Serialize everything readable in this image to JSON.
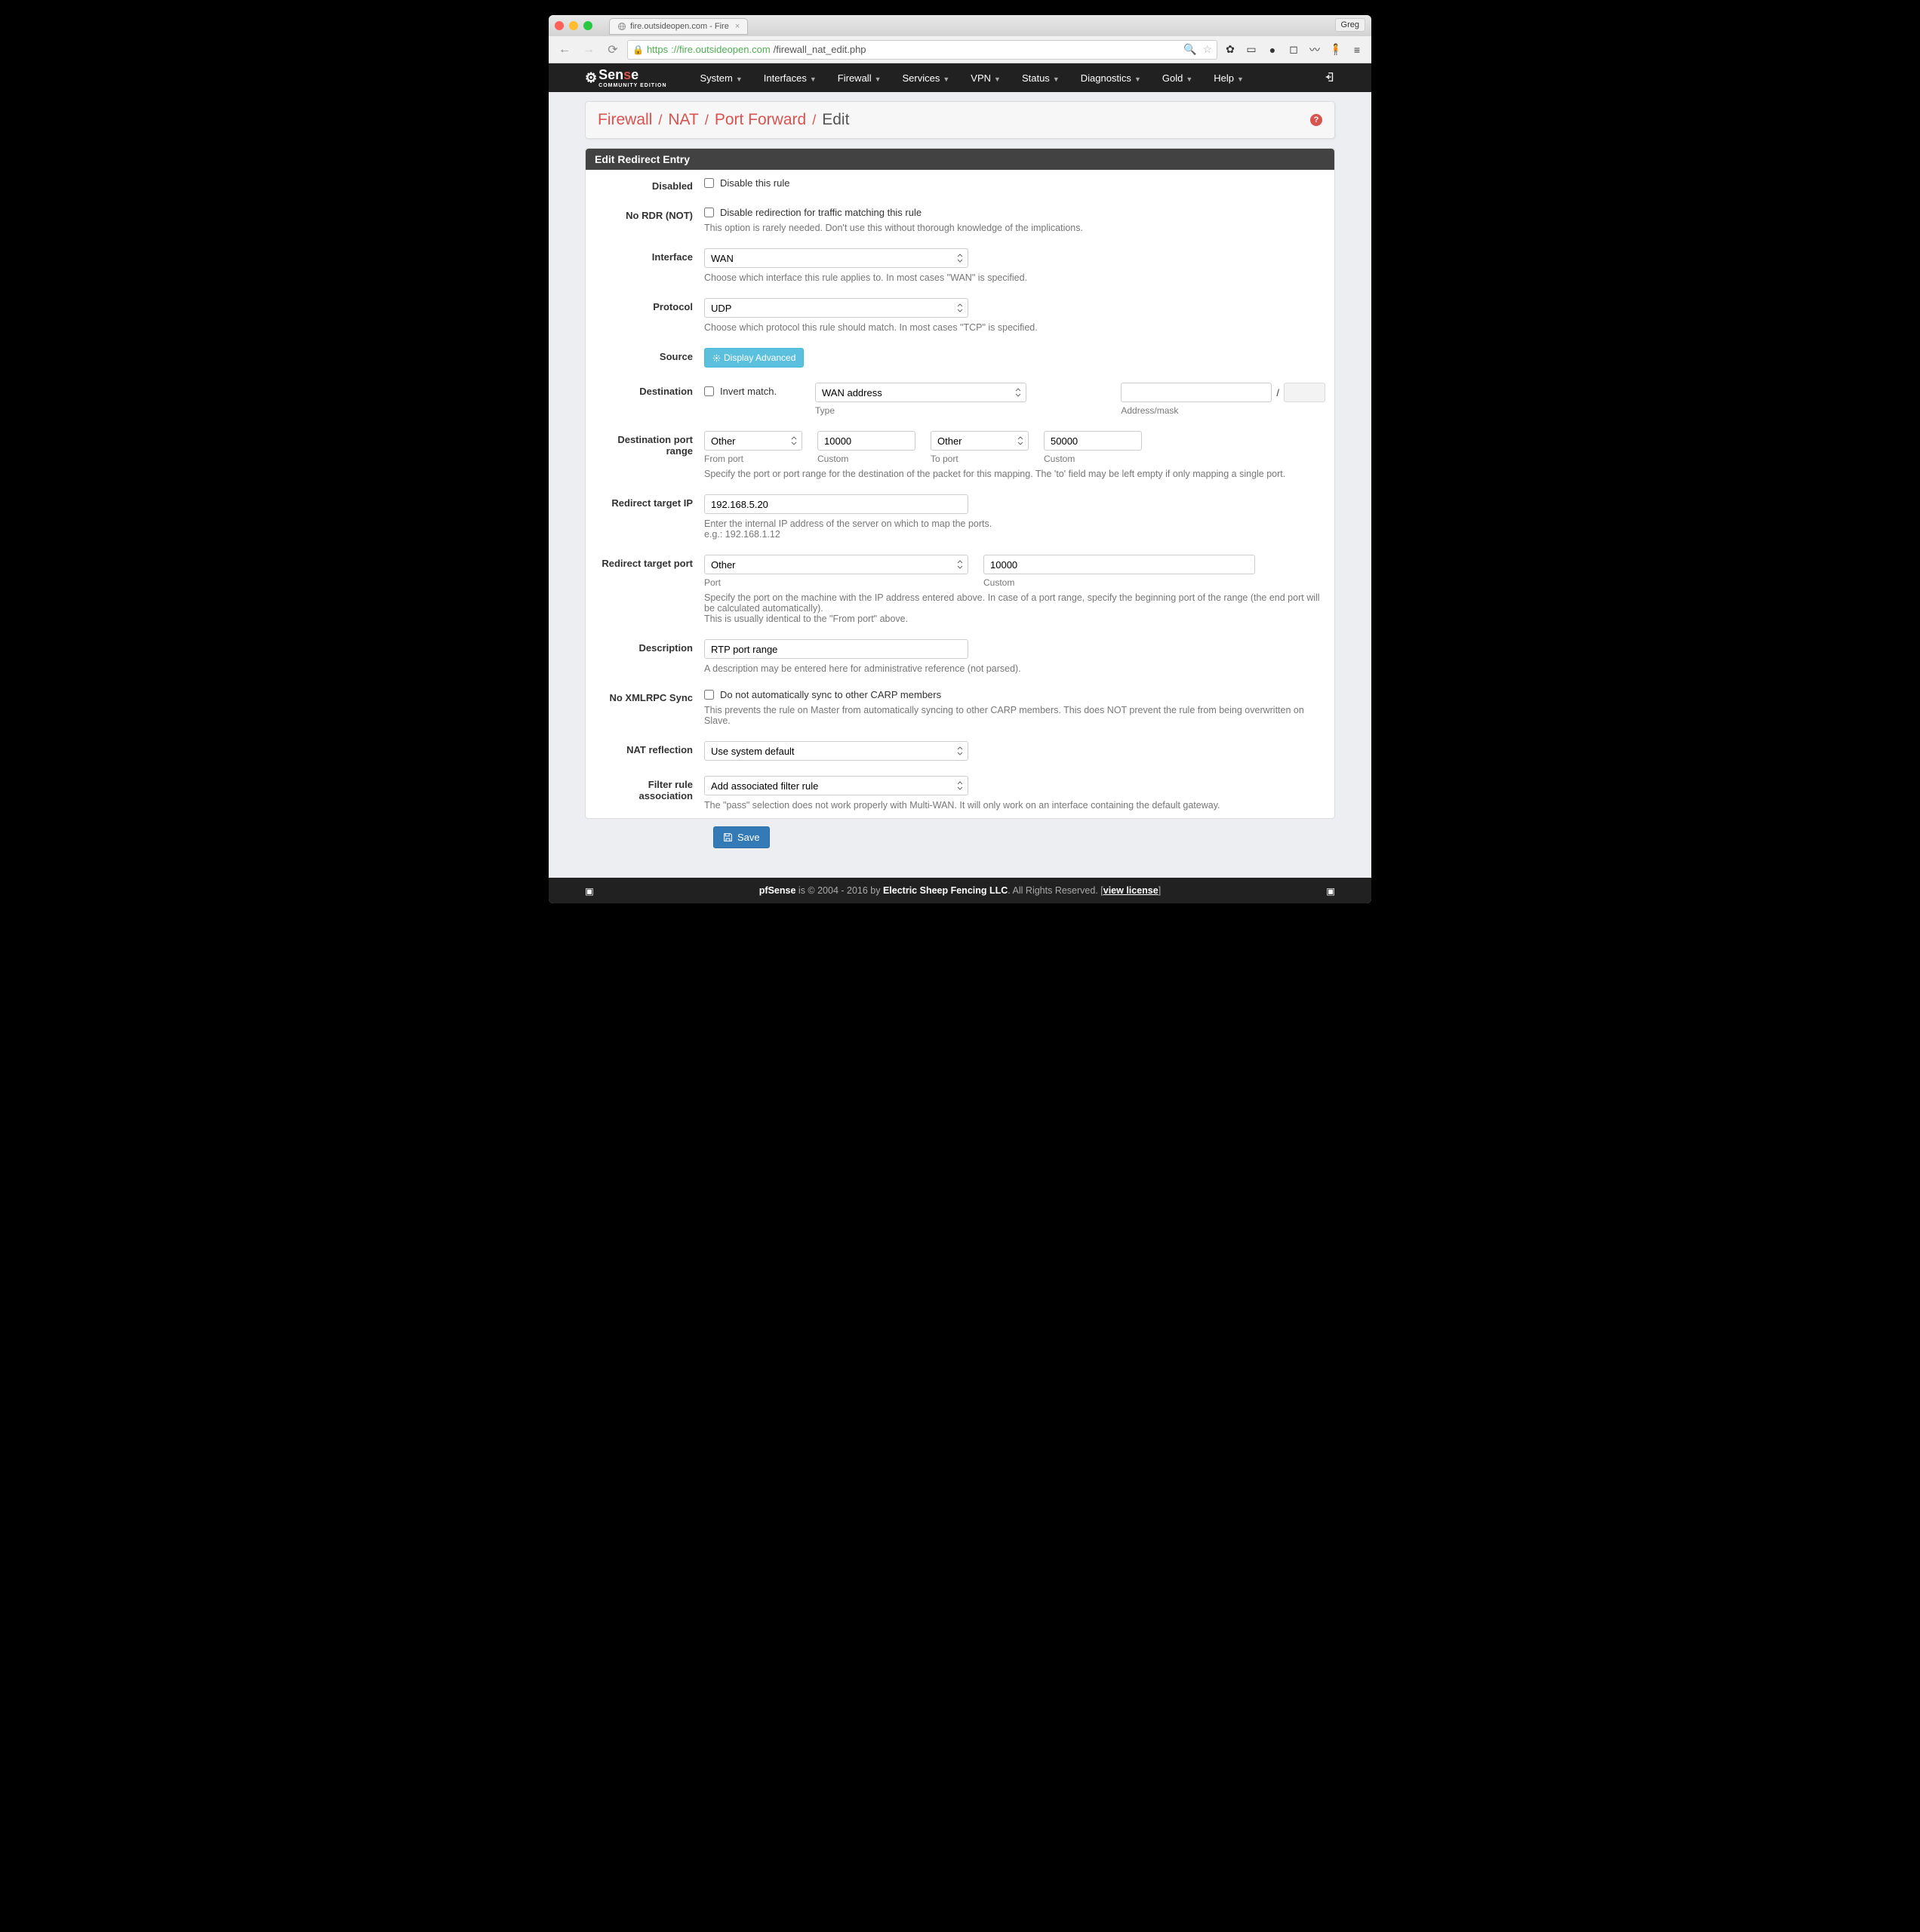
{
  "browser": {
    "tab_title": "fire.outsideopen.com - Fire",
    "user": "Greg",
    "url_scheme": "https",
    "url_host": "://fire.outsideopen.com",
    "url_path": "/firewall_nat_edit.php"
  },
  "logo": {
    "text1": "Sen",
    "text2": "s",
    "text3": "e",
    "sub": "COMMUNITY EDITION"
  },
  "menu": [
    "System",
    "Interfaces",
    "Firewall",
    "Services",
    "VPN",
    "Status",
    "Diagnostics",
    "Gold",
    "Help"
  ],
  "breadcrumb": [
    "Firewall",
    "NAT",
    "Port Forward",
    "Edit"
  ],
  "panel_title": "Edit Redirect Entry",
  "labels": {
    "disabled": "Disabled",
    "nordr": "No RDR (NOT)",
    "interface": "Interface",
    "protocol": "Protocol",
    "source": "Source",
    "destination": "Destination",
    "dst_port": "Destination port range",
    "redir_ip": "Redirect target IP",
    "redir_port": "Redirect target port",
    "description": "Description",
    "noxml": "No XMLRPC Sync",
    "natrefl": "NAT reflection",
    "filterassoc": "Filter rule association"
  },
  "fields": {
    "disabled_label": "Disable this rule",
    "nordr_label": "Disable redirection for traffic matching this rule",
    "nordr_help": "This option is rarely needed. Don't use this without thorough knowledge of the implications.",
    "interface_value": "WAN",
    "interface_help": "Choose which interface this rule applies to. In most cases \"WAN\" is specified.",
    "protocol_value": "UDP",
    "protocol_help": "Choose which protocol this rule should match. In most cases \"TCP\" is specified.",
    "advanced_btn": "Display Advanced",
    "dest_invert": "Invert match.",
    "dest_type": "WAN address",
    "dest_mask_sep": "/",
    "dest_sub_type": "Type",
    "dest_sub_addr": "Address/mask",
    "dpr_from_sel": "Other",
    "dpr_from_custom": "10000",
    "dpr_to_sel": "Other",
    "dpr_to_custom": "50000",
    "dpr_from_label": "From port",
    "dpr_custom_label": "Custom",
    "dpr_to_label": "To port",
    "dpr_help": "Specify the port or port range for the destination of the packet for this mapping. The 'to' field may be left empty if only mapping a single port.",
    "redir_ip_value": "192.168.5.20",
    "redir_ip_help1": "Enter the internal IP address of the server on which to map the ports.",
    "redir_ip_help2": "e.g.: 192.168.1.12",
    "redir_port_sel": "Other",
    "redir_port_custom": "10000",
    "redir_port_label": "Port",
    "redir_custom_label": "Custom",
    "redir_port_help1": "Specify the port on the machine with the IP address entered above. In case of a port range, specify the beginning port of the range (the end port will be calculated automatically).",
    "redir_port_help2": "This is usually identical to the \"From port\" above.",
    "description_value": "RTP port range",
    "description_help": "A description may be entered here for administrative reference (not parsed).",
    "noxml_label": "Do not automatically sync to other CARP members",
    "noxml_help": "This prevents the rule on Master from automatically syncing to other CARP members. This does NOT prevent the rule from being overwritten on Slave.",
    "natrefl_value": "Use system default",
    "filterassoc_value": "Add associated filter rule",
    "filterassoc_help": "The \"pass\" selection does not work properly with Multi-WAN. It will only work on an interface containing the default gateway.",
    "save": "Save"
  },
  "footer": {
    "product": "pfSense",
    "copy": " is © 2004 - 2016 by ",
    "company": "Electric Sheep Fencing LLC",
    "rights": ". All Rights Reserved. [",
    "license": "view license",
    "close": "]"
  }
}
